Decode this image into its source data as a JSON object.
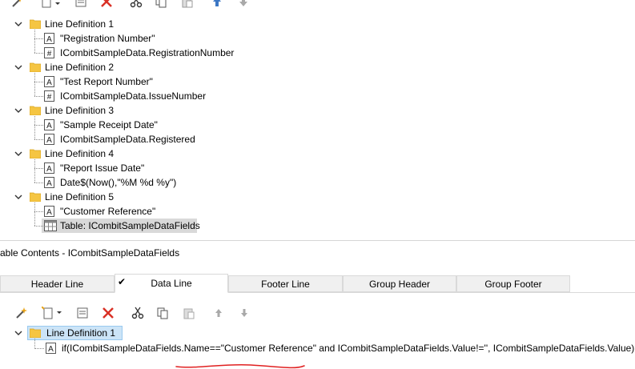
{
  "top_tree": {
    "definitions": [
      {
        "label": "Line Definition  1",
        "children": [
          {
            "type": "text",
            "label": "\"Registration Number\""
          },
          {
            "type": "numeric",
            "label": "ICombitSampleData.RegistrationNumber"
          }
        ]
      },
      {
        "label": "Line Definition  2",
        "children": [
          {
            "type": "text",
            "label": "\"Test Report Number\""
          },
          {
            "type": "numeric",
            "label": "ICombitSampleData.IssueNumber"
          }
        ]
      },
      {
        "label": "Line Definition  3",
        "children": [
          {
            "type": "text",
            "label": "\"Sample Receipt Date\""
          },
          {
            "type": "text",
            "label": "ICombitSampleData.Registered"
          }
        ]
      },
      {
        "label": "Line Definition  4",
        "children": [
          {
            "type": "text",
            "label": "\"Report Issue Date\""
          },
          {
            "type": "text",
            "label": "Date$(Now(),\"%M %d %y\")"
          }
        ]
      },
      {
        "label": "Line Definition  5",
        "children": [
          {
            "type": "text",
            "label": "\"Customer Reference\""
          },
          {
            "type": "table",
            "label": "Table: ICombitSampleDataFields"
          }
        ]
      }
    ]
  },
  "table_contents": {
    "title": "able Contents - ICombitSampleDataFields",
    "tabs": [
      {
        "label": "Header Line",
        "active": false
      },
      {
        "label": "Data Line",
        "active": true
      },
      {
        "label": "Footer Line",
        "active": false
      },
      {
        "label": "Group Header",
        "active": false
      },
      {
        "label": "Group Footer",
        "active": false
      }
    ],
    "tree": {
      "definition_label": "Line Definition  1",
      "child_label": "if(ICombitSampleDataFields.Name==\"Customer Reference\" and ICombitSampleDataFields.Value!='', ICombitSampleDataFields.Value)"
    }
  },
  "colors": {
    "folder": "#f5c542",
    "delete_red": "#d93025",
    "arrow_blue": "#3b77c4",
    "selection_blue": "#cce4f7",
    "annotation_red": "#e02020"
  }
}
